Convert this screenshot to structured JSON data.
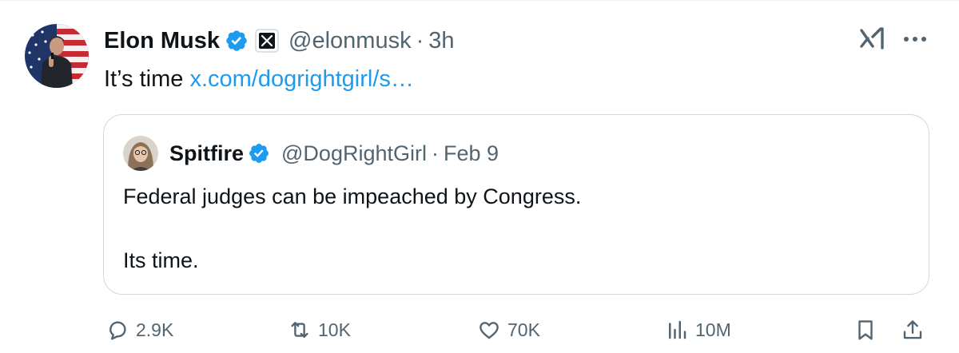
{
  "post": {
    "author_name": "Elon Musk",
    "author_handle": "@elonmusk",
    "separator": "·",
    "time": "3h",
    "text": "It’s time",
    "link": "x.com/dogrightgirl/s…"
  },
  "quoted_post": {
    "author_name": "Spitfire",
    "author_handle": "@DogRightGirl",
    "separator": "·",
    "date": "Feb 9",
    "line1": "Federal judges can be impeached by Congress.",
    "line2": "Its time."
  },
  "actions": {
    "replies": "2.9K",
    "reposts": "10K",
    "likes": "70K",
    "views": "10M"
  },
  "colors": {
    "accent": "#1d9bf0",
    "secondary_text": "#536471",
    "primary_text": "#0f1419",
    "border": "#cfd9de"
  },
  "icons": [
    "verified-badge-icon",
    "x-logo-icon",
    "grok-icon",
    "more-icon",
    "reply-icon",
    "repost-icon",
    "like-icon",
    "views-icon",
    "bookmark-icon",
    "share-icon"
  ]
}
